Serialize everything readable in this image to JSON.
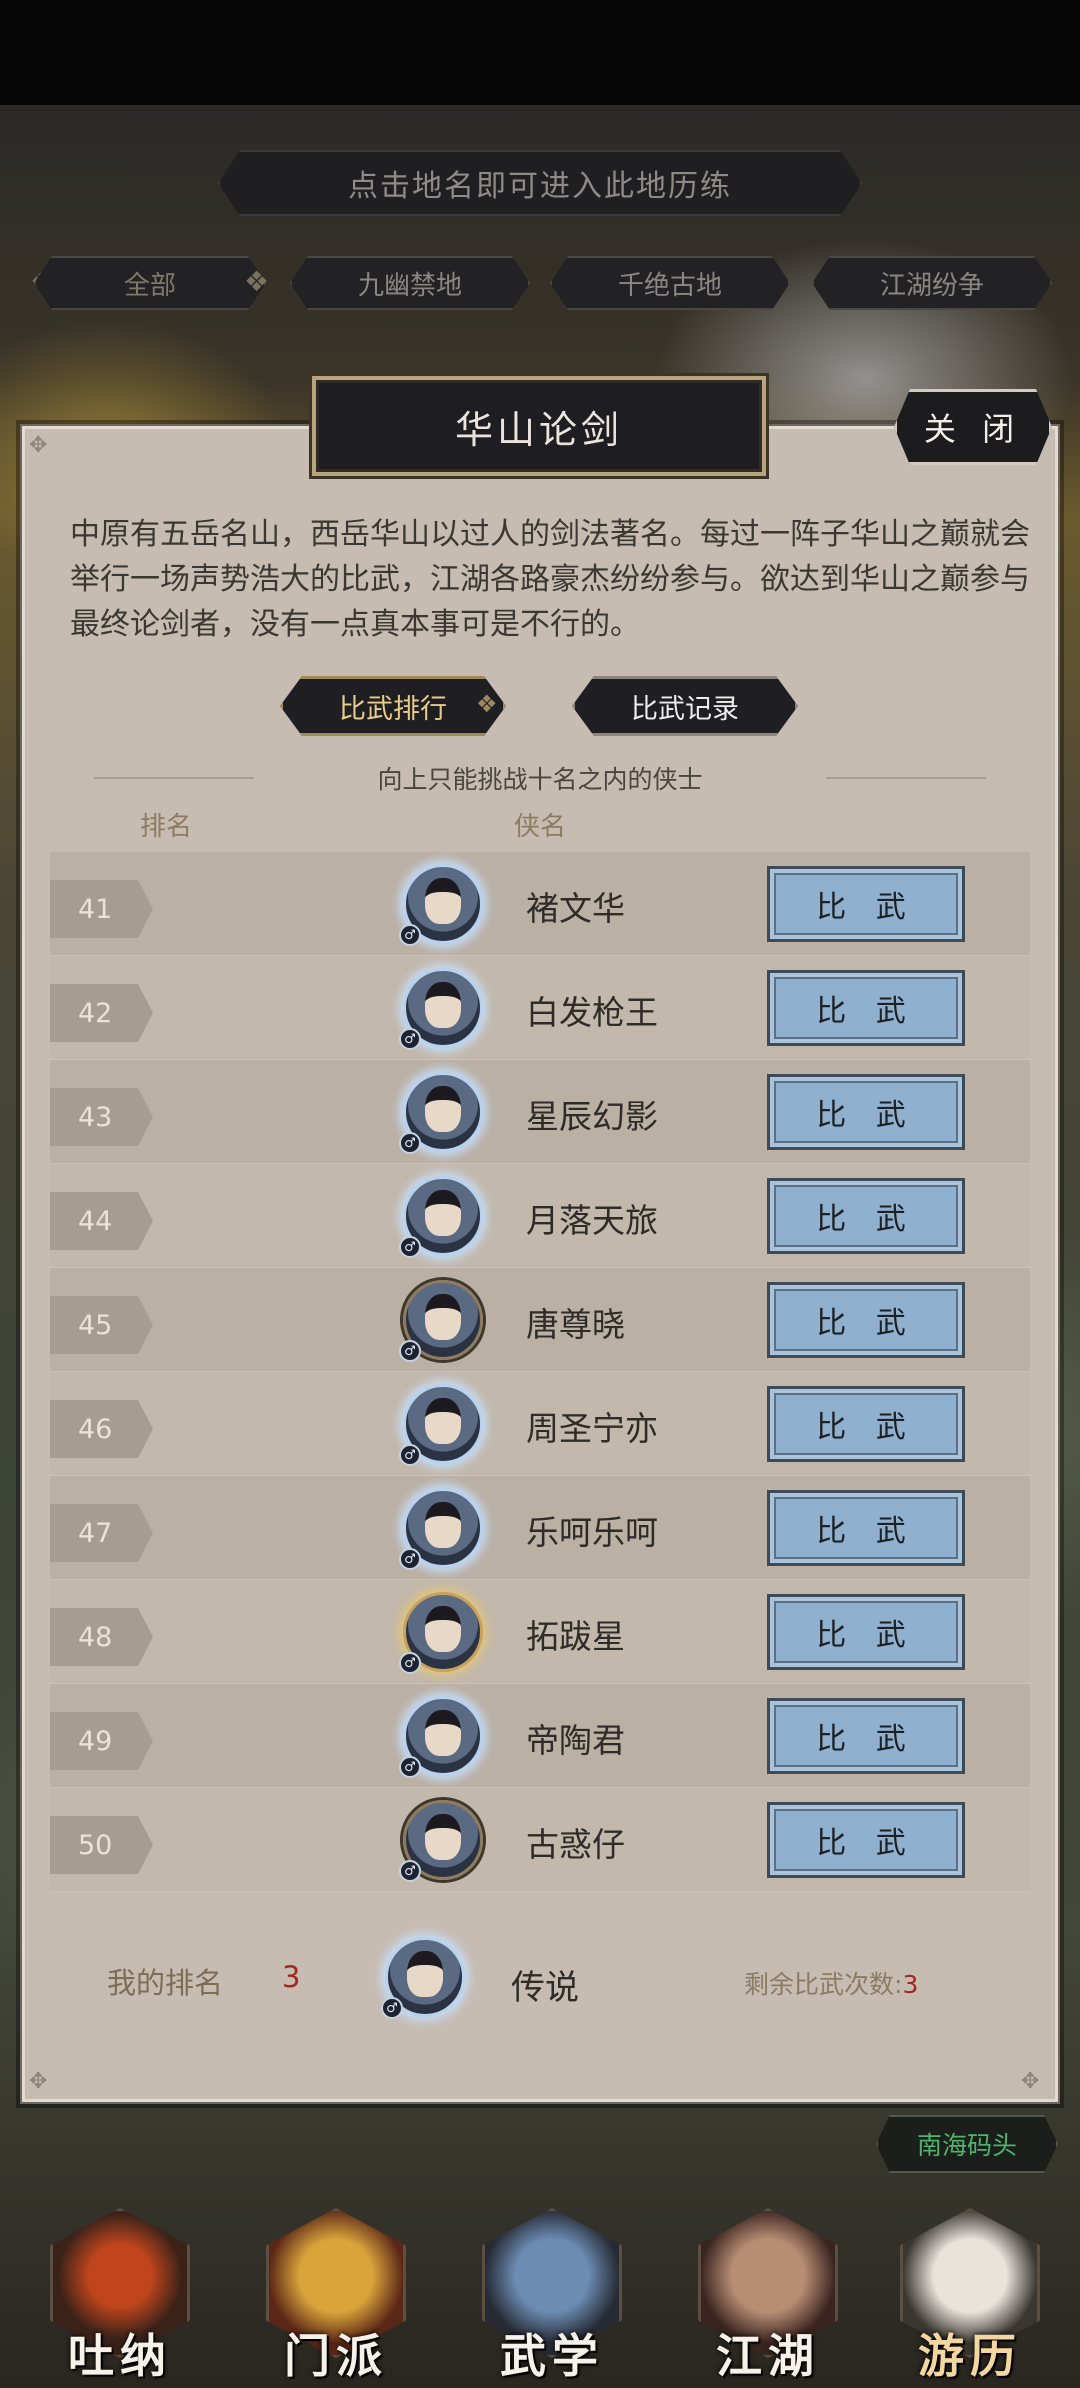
{
  "hint_bar": "点击地名即可进入此地历练",
  "filter_tabs": [
    "全部",
    "九幽禁地",
    "千绝古地",
    "江湖纷争"
  ],
  "dialog": {
    "title": "华山论剑",
    "close_label": "关 闭",
    "description": "中原有五岳名山，西岳华山以过人的剑法著名。每过一阵子华山之巅就会举行一场声势浩大的比武，江湖各路豪杰纷纷参与。欲达到华山之巅参与最终论剑者，没有一点真本事可是不行的。",
    "segments": [
      {
        "label": "比武排行",
        "active": true
      },
      {
        "label": "比武记录",
        "active": false
      }
    ],
    "hint": "向上只能挑战十名之内的侠士",
    "columns": {
      "rank": "排名",
      "name": "侠名"
    },
    "rows": [
      {
        "rank": "41",
        "name": "褚文华",
        "frame": "glow",
        "action": "比 武"
      },
      {
        "rank": "42",
        "name": "白发枪王",
        "frame": "glow",
        "action": "比 武"
      },
      {
        "rank": "43",
        "name": "星辰幻影",
        "frame": "glow",
        "action": "比 武"
      },
      {
        "rank": "44",
        "name": "月落天旅",
        "frame": "glow",
        "action": "比 武"
      },
      {
        "rank": "45",
        "name": "唐尊晓",
        "frame": "plain",
        "action": "比 武"
      },
      {
        "rank": "46",
        "name": "周圣宁亦",
        "frame": "glow",
        "action": "比 武"
      },
      {
        "rank": "47",
        "name": "乐呵乐呵",
        "frame": "glow",
        "action": "比 武"
      },
      {
        "rank": "48",
        "name": "拓跋星",
        "frame": "gold",
        "action": "比 武"
      },
      {
        "rank": "49",
        "name": "帝陶君",
        "frame": "glow",
        "action": "比 武"
      },
      {
        "rank": "50",
        "name": "古惑仔",
        "frame": "plain",
        "action": "比 武"
      }
    ],
    "my_rank": {
      "label": "我的排名",
      "value": "3",
      "name": "传说",
      "remaining_label": "剩余比武次数:",
      "remaining_value": "3"
    }
  },
  "location_button": "南海码头",
  "bottom_nav": [
    {
      "label": "吐纳",
      "icon": "meditation-icon"
    },
    {
      "label": "门派",
      "icon": "sect-flag-icon"
    },
    {
      "label": "武学",
      "icon": "martial-book-icon"
    },
    {
      "label": "江湖",
      "icon": "hat-icon"
    },
    {
      "label": "游历",
      "icon": "horse-icon",
      "active": true
    }
  ],
  "colors": {
    "panel": "#c6bcb2",
    "fight_button": "#8fb0cf",
    "accent_gold": "#e7cc8a",
    "rank_red": "#a0281e",
    "location_green": "#4fb46e"
  }
}
